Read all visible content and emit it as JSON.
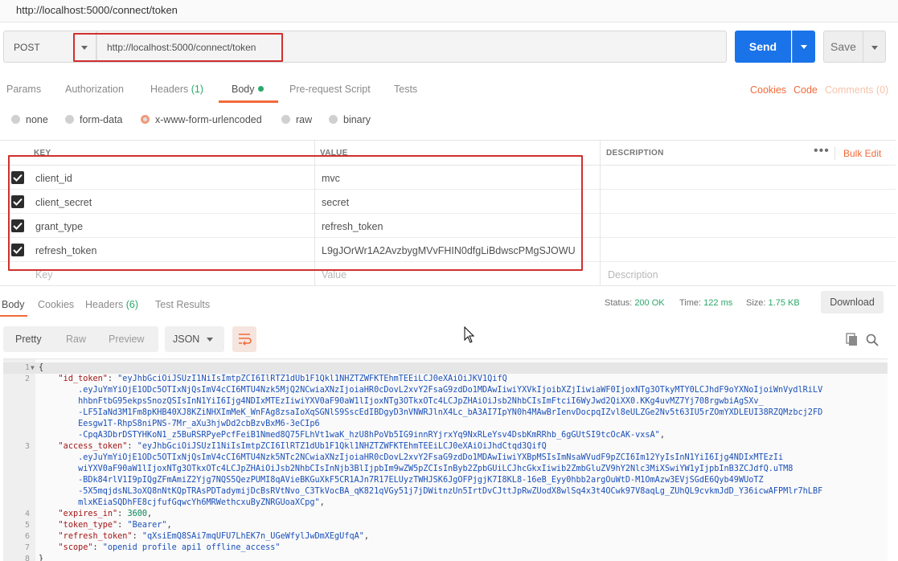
{
  "window": {
    "title": "http://localhost:5000/connect/token"
  },
  "request": {
    "method": "POST",
    "url": "http://localhost:5000/connect/token",
    "send_label": "Send",
    "save_label": "Save"
  },
  "tabs": {
    "params": "Params",
    "authorization": "Authorization",
    "headers": "Headers",
    "headers_count": "(1)",
    "body": "Body",
    "prerequest": "Pre-request Script",
    "tests": "Tests",
    "cookies": "Cookies",
    "code": "Code",
    "comments": "Comments (0)"
  },
  "body_types": {
    "none": "none",
    "form_data": "form-data",
    "urlencoded": "x-www-form-urlencoded",
    "raw": "raw",
    "binary": "binary",
    "selected": "x-www-form-urlencoded"
  },
  "kv_table": {
    "headers": {
      "key": "KEY",
      "value": "VALUE",
      "description": "DESCRIPTION"
    },
    "bulk_edit": "Bulk Edit",
    "rows": [
      {
        "key": "client_id",
        "value": "mvc",
        "checked": true
      },
      {
        "key": "client_secret",
        "value": "secret",
        "checked": true
      },
      {
        "key": "grant_type",
        "value": "refresh_token",
        "checked": true
      },
      {
        "key": "refresh_token",
        "value": "L9gJOrWr1A2AvzbygMVvFHIN0dfgLiBdwscPMgSJOWU",
        "checked": true
      }
    ],
    "placeholder": {
      "key": "Key",
      "value": "Value",
      "description": "Description"
    }
  },
  "response": {
    "tabs": {
      "body": "Body",
      "cookies": "Cookies",
      "headers": "Headers",
      "headers_count": "(6)",
      "test_results": "Test Results"
    },
    "status_label": "Status:",
    "status": "200 OK",
    "time_label": "Time:",
    "time": "122 ms",
    "size_label": "Size:",
    "size": "1.75 KB",
    "download_label": "Download",
    "format": {
      "pretty": "Pretty",
      "raw": "Raw",
      "preview": "Preview",
      "lang": "JSON"
    }
  },
  "code_lines": [
    {
      "n": "1",
      "fold": true,
      "parts": [
        [
          "pun",
          "{"
        ]
      ]
    },
    {
      "n": "2",
      "parts": [
        [
          "pun",
          "    "
        ],
        [
          "key",
          "\"id_token\""
        ],
        [
          "pun",
          ": "
        ],
        [
          "str",
          "\"eyJhbGciOiJSUzI1NiIsImtpZCI6IlRTZ1dUb1F1Qkl1NHZTZWFKTEhmTEEiLCJ0eXAiOiJKV1QifQ"
        ]
      ]
    },
    {
      "n": "",
      "parts": [
        [
          "str",
          "        .eyJuYmYiOjE1ODc5OTIxNjQsImV4cCI6MTU4Nzk5MjQ2NCwiaXNzIjoiaHR0cDovL2xvY2FsaG9zdDo1MDAwIiwiYXVkIjoibXZjIiwiaWF0IjoxNTg3OTkyMTY0LCJhdF9oYXNoIjoiWnVydlRiLV"
        ]
      ]
    },
    {
      "n": "",
      "parts": [
        [
          "str",
          "        hhbnFtbG95ekpsSnozQSIsInN1YiI6Ijg4NDIxMTEzIiwiYXV0aF90aW1lIjoxNTg3OTkxOTc4LCJpZHAiOiJsb2NhbCIsImFtciI6WyJwd2QiXX0.KKg4uvMZ7Yj708rgwbiAgSXv_"
        ]
      ]
    },
    {
      "n": "",
      "parts": [
        [
          "str",
          "        -LF5IaNd3M1Fm8pKHB40XJ8KZiNHXImMeK_WnFAg8zsaIoXqSGNlS9SscEdIBDgyD3nVNWRJlnX4Lc_bA3AI7IpYN0h4MAwBrIenvDocpqIZvl8eULZGe2Nv5t63IU5rZOmYXDLEUI38RZQMzbcj2FD"
        ]
      ]
    },
    {
      "n": "",
      "parts": [
        [
          "str",
          "        Eesgw1T-RhpS8niPNS-7Mr_aXu3hjwDd2cbBzvBxM6-3eCIp6"
        ]
      ]
    },
    {
      "n": "",
      "parts": [
        [
          "str",
          "        -CpqA3DbrDSTYHKoN1_z5BuRSRPyePcfFeiB1Nmed8Q75FLhVt1waK_hzU8hPoVb5IG9innRYjrxYq9NxRLeYsv4DsbKmRRhb_6gGUtSI9tcOcAK-vxsA\""
        ],
        [
          "pun",
          ","
        ]
      ]
    },
    {
      "n": "3",
      "parts": [
        [
          "pun",
          "    "
        ],
        [
          "key",
          "\"access_token\""
        ],
        [
          "pun",
          ": "
        ],
        [
          "str",
          "\"eyJhbGciOiJSUzI1NiIsImtpZCI6IlRTZ1dUb1F1Qkl1NHZTZWFKTEhmTEEiLCJ0eXAiOiJhdCtqd3QifQ"
        ]
      ]
    },
    {
      "n": "",
      "parts": [
        [
          "str",
          "        .eyJuYmYiOjE1ODc5OTIxNjQsImV4cCI6MTU4Nzk5NTc2NCwiaXNzIjoiaHR0cDovL2xvY2FsaG9zdDo1MDAwIiwiYXBpMSIsImNsaWVudF9pZCI6Im12YyIsInN1YiI6Ijg4NDIxMTEzIi"
        ]
      ]
    },
    {
      "n": "",
      "parts": [
        [
          "str",
          "        wiYXV0aF90aW1lIjoxNTg3OTkxOTc4LCJpZHAiOiJsb2NhbCIsInNjb3BlIjpbIm9wZW5pZCIsInByb2ZpbGUiLCJhcGkxIiwib2ZmbGluZV9hY2Nlc3MiXSwiYW1yIjpbInB3ZCJdfQ.uTM8"
        ]
      ]
    },
    {
      "n": "",
      "parts": [
        [
          "str",
          "        -BDk84rlV1I9pIQgZFmAmiZ2Yjg7NQS5QezPUMI8qAVieBKGuXkF5CR1AJn7R17ELUyzTWHJSK6JgOFPjgjK7I8KL8-16eB_Eyy0hbb2argOuWtD-M1OmAzw3EVjSGdE6Qyb49WUoTZ"
        ]
      ]
    },
    {
      "n": "",
      "parts": [
        [
          "str",
          "        -5X5mqjdsNL3oXQ8nNtKQpTRAsPDTadymijDcBsRVtNvo_C3TkVocBA_qK821qVGy51j7jDWitnzUn5IrtDvCJttJpRwZUodX8wlSq4x3t4OCwk97V8aqLg_ZUhQL9cvkmJdD_Y36icwAFPMlr7hLBF"
        ]
      ]
    },
    {
      "n": "",
      "parts": [
        [
          "str",
          "        mlxKEiaSQDhFE8cjfufGqwcYh6MRWethcxuByZNRGUoaXCpg\""
        ],
        [
          "pun",
          ","
        ]
      ]
    },
    {
      "n": "4",
      "parts": [
        [
          "pun",
          "    "
        ],
        [
          "key",
          "\"expires_in\""
        ],
        [
          "pun",
          ": "
        ],
        [
          "num",
          "3600"
        ],
        [
          "pun",
          ","
        ]
      ]
    },
    {
      "n": "5",
      "parts": [
        [
          "pun",
          "    "
        ],
        [
          "key",
          "\"token_type\""
        ],
        [
          "pun",
          ": "
        ],
        [
          "str",
          "\"Bearer\""
        ],
        [
          "pun",
          ","
        ]
      ]
    },
    {
      "n": "6",
      "parts": [
        [
          "pun",
          "    "
        ],
        [
          "key",
          "\"refresh_token\""
        ],
        [
          "pun",
          ": "
        ],
        [
          "str",
          "\"qXsiEmQ8SAi7mqUFU7LhEK7n_UGeWfylJwDmXEgUfqA\""
        ],
        [
          "pun",
          ","
        ]
      ]
    },
    {
      "n": "7",
      "parts": [
        [
          "pun",
          "    "
        ],
        [
          "key",
          "\"scope\""
        ],
        [
          "pun",
          ": "
        ],
        [
          "str",
          "\"openid profile api1 offline_access\""
        ]
      ]
    },
    {
      "n": "8",
      "parts": [
        [
          "pun",
          "}"
        ]
      ]
    }
  ],
  "colors": {
    "accent": "#f26b3a",
    "send": "#1a73e8",
    "success": "#2aa86a",
    "annotation": "#d0302e"
  }
}
